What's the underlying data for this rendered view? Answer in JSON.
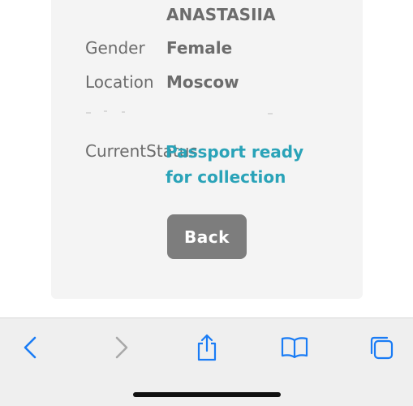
{
  "profile": {
    "name": "ANASTASIIA",
    "gender_label": "Gender",
    "gender_value": "Female",
    "location_label": "Location",
    "location_value": "Moscow",
    "status_label": "CurrentStatus",
    "status_value": "Passport ready for collection"
  },
  "actions": {
    "back_label": "Back"
  },
  "toolbar": {
    "items": [
      "chevron-left-icon",
      "chevron-right-icon",
      "share-icon",
      "book-icon",
      "tabs-icon"
    ]
  },
  "colors": {
    "status_accent": "#2aa3b8",
    "button_bg": "#7d7d7d",
    "card_bg": "#f4f4f4",
    "toolbar_blue": "#1a7cf5"
  }
}
